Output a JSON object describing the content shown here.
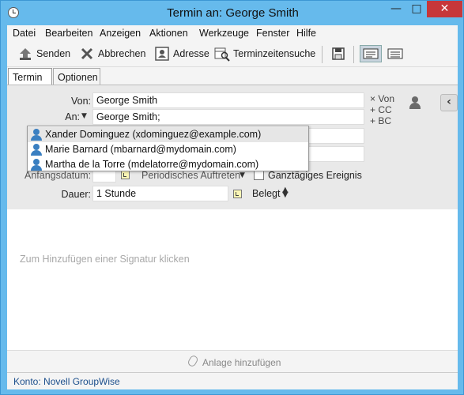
{
  "window": {
    "title": "Termin an: George Smith",
    "minimize_label": "—",
    "maximize_label": "□",
    "close_label": "✕"
  },
  "menu": [
    "Datei",
    "Bearbeiten",
    "Anzeigen",
    "Aktionen",
    "Werkzeuge",
    "Fenster",
    "Hilfe"
  ],
  "toolbar": {
    "send_label": "Senden",
    "cancel_label": "Abbrechen",
    "address_label": "Adresse",
    "schedule_search_label": "Terminzeitensuche"
  },
  "tabs": [
    "Termin",
    "Optionen"
  ],
  "form": {
    "from_label": "Von:",
    "from_value": "George Smith",
    "to_label": "An:",
    "to_value": "George Smith;",
    "side_links": [
      "× Von",
      "+ CC",
      "+ BC"
    ],
    "start_label": "Anfangsdatum:",
    "start_value": "",
    "recurring_label": "Periodisches Auftreten",
    "allday_label": "Ganztägiges Ereignis",
    "duration_label": "Dauer:",
    "duration_value": "1 Stunde",
    "busy_label": "Belegt"
  },
  "suggestions": [
    "Xander Dominguez (xdominguez@example.com)",
    "Marie Barnard (mbarnard@mydomain.com)",
    "Martha de la Torre (mdelatorre@mydomain.com)"
  ],
  "body": {
    "signature_hint": "Zum Hinzufügen einer Signatur klicken"
  },
  "attachment": {
    "label": "Anlage hinzufügen"
  },
  "status": {
    "account": "Konto: Novell GroupWise"
  },
  "colors": {
    "titlebar": "#66baec",
    "close_button": "#c7373a",
    "status_text": "#1c4f8c"
  }
}
